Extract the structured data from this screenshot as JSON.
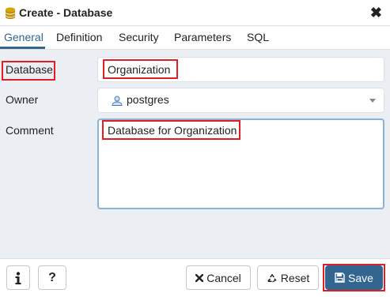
{
  "dialog": {
    "title": "Create - Database",
    "close_label": "✖"
  },
  "tabs": [
    {
      "label": "General",
      "active": true
    },
    {
      "label": "Definition"
    },
    {
      "label": "Security"
    },
    {
      "label": "Parameters"
    },
    {
      "label": "SQL"
    }
  ],
  "form": {
    "database_label": "Database",
    "database_value": "Organization",
    "owner_label": "Owner",
    "owner_value": "postgres",
    "comment_label": "Comment",
    "comment_value": "Database for Organization"
  },
  "footer": {
    "info_icon": "info-icon",
    "help_label": "?",
    "cancel_label": "Cancel",
    "reset_label": "Reset",
    "save_label": "Save"
  },
  "colors": {
    "accent": "#326690",
    "highlight": "#e01f25",
    "background": "#ebeef3"
  }
}
